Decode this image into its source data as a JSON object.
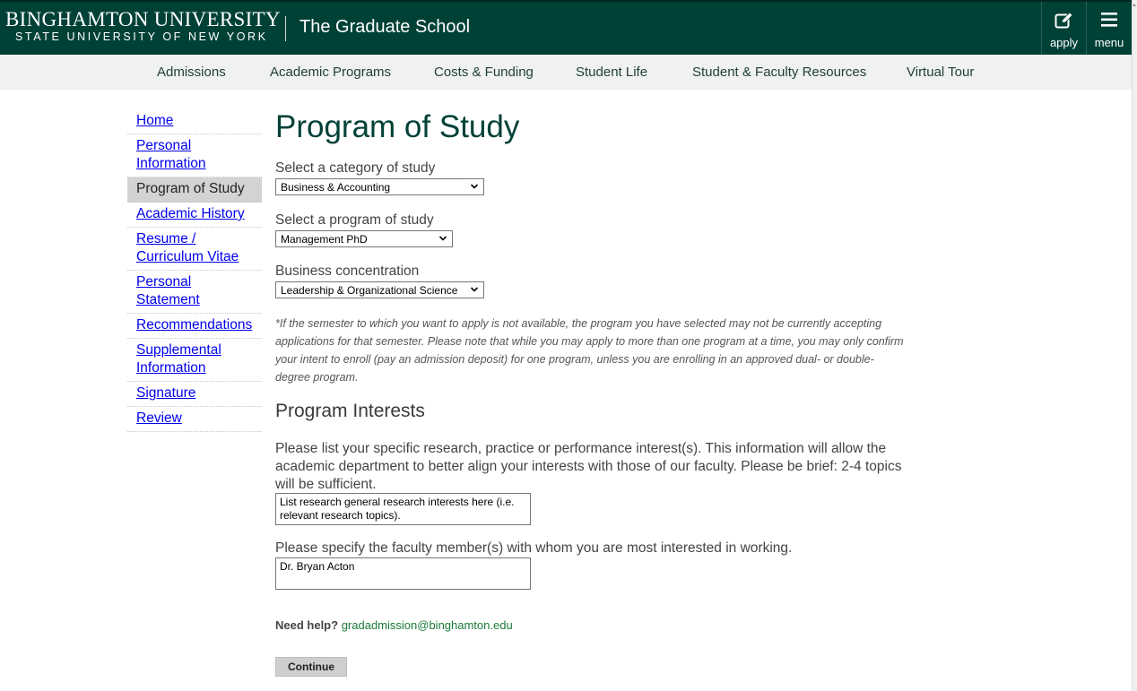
{
  "header": {
    "logo_main": "BINGHAMTON UNIVERSITY",
    "logo_sub": "STATE UNIVERSITY OF NEW YORK",
    "school_name": "The Graduate School",
    "apply_label": "apply",
    "menu_label": "menu",
    "background": "#004137"
  },
  "nav": {
    "items": [
      "Admissions",
      "Academic Programs",
      "Costs & Funding",
      "Student Life",
      "Student & Faculty Resources",
      "Virtual Tour"
    ]
  },
  "sidebar": {
    "items": [
      {
        "label": "Home"
      },
      {
        "label": "Personal Information"
      },
      {
        "label": "Program of Study",
        "active": true
      },
      {
        "label": "Academic History"
      },
      {
        "label": "Resume / Curriculum Vitae"
      },
      {
        "label": "Personal Statement"
      },
      {
        "label": "Recommendations"
      },
      {
        "label": "Supplemental Information"
      },
      {
        "label": "Signature"
      },
      {
        "label": "Review"
      }
    ]
  },
  "main": {
    "title": "Program of Study",
    "category": {
      "label": "Select a category of study",
      "value": "Business & Accounting"
    },
    "program": {
      "label": "Select a program of study",
      "value": "Management PhD"
    },
    "concentration": {
      "label": "Business concentration",
      "value": "Leadership & Organizational Science"
    },
    "note": "*If the semester to which you want to apply is not available, the program you have selected may not be currently accepting applications for that semester.  Please note that while you may apply to more than one program at a time, you may only confirm your intent to enroll (pay an admission deposit) for one program, unless you are enrolling in an approved dual- or double-degree program.",
    "interests_title": "Program Interests",
    "interests_prompt": "Please list your specific research, practice or performance interest(s). This information will allow the academic department to better align your interests with those of our faculty. Please be brief: 2-4 topics will be sufficient.",
    "interests_value": "List research general research interests here (i.e. relevant research topics).",
    "faculty_prompt": "Please specify the faculty member(s) with whom you are most interested in working.",
    "faculty_value": "Dr. Bryan Acton",
    "help_label": "Need help?",
    "help_email": "gradadmission@binghamton.edu",
    "continue_label": "Continue"
  }
}
